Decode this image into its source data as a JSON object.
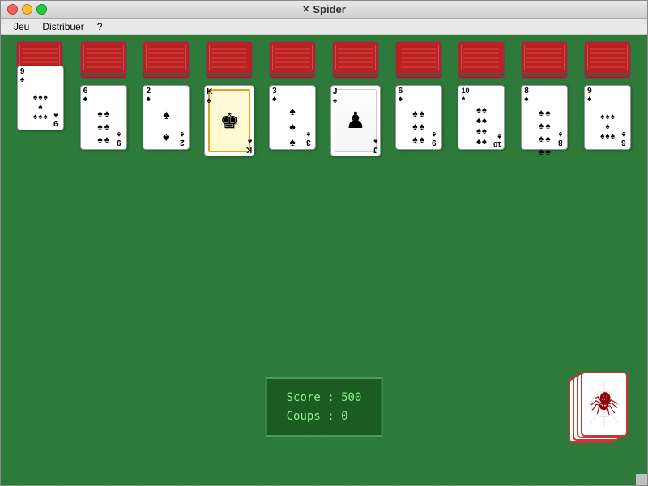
{
  "window": {
    "title": "Spider",
    "title_icon": "🕷"
  },
  "menu": {
    "items": [
      "Jeu",
      "Distribuer",
      "?"
    ]
  },
  "columns": [
    {
      "id": 0,
      "stacks": 4,
      "top_card": "9",
      "suit": "♠",
      "bottom_rank": "9"
    },
    {
      "id": 1,
      "stacks": 4,
      "top_card": "6",
      "suit": "♠",
      "bottom_rank": "9"
    },
    {
      "id": 2,
      "stacks": 4,
      "top_card": "2",
      "suit": "♠",
      "bottom_rank": "2"
    },
    {
      "id": 3,
      "stacks": 4,
      "top_card": "K",
      "suit": "♠",
      "bottom_rank": "K",
      "special": "king"
    },
    {
      "id": 4,
      "stacks": 4,
      "top_card": "3",
      "suit": "♠",
      "bottom_rank": "3"
    },
    {
      "id": 5,
      "stacks": 4,
      "top_card": "J",
      "suit": "♠",
      "bottom_rank": "J",
      "special": "jack"
    },
    {
      "id": 6,
      "stacks": 4,
      "top_card": "6",
      "suit": "♠",
      "bottom_rank": "9"
    },
    {
      "id": 7,
      "stacks": 4,
      "top_card": "10",
      "suit": "♠",
      "bottom_rank": "10"
    },
    {
      "id": 8,
      "stacks": 4,
      "top_card": "8",
      "suit": "♠",
      "bottom_rank": "8"
    },
    {
      "id": 9,
      "stacks": 4,
      "top_card": "9",
      "suit": "♠",
      "bottom_rank": "6"
    }
  ],
  "score": {
    "label_score": "Score :",
    "score_value": "500",
    "label_coups": "Coups :",
    "coups_value": "0"
  },
  "stock": {
    "count": 4
  }
}
